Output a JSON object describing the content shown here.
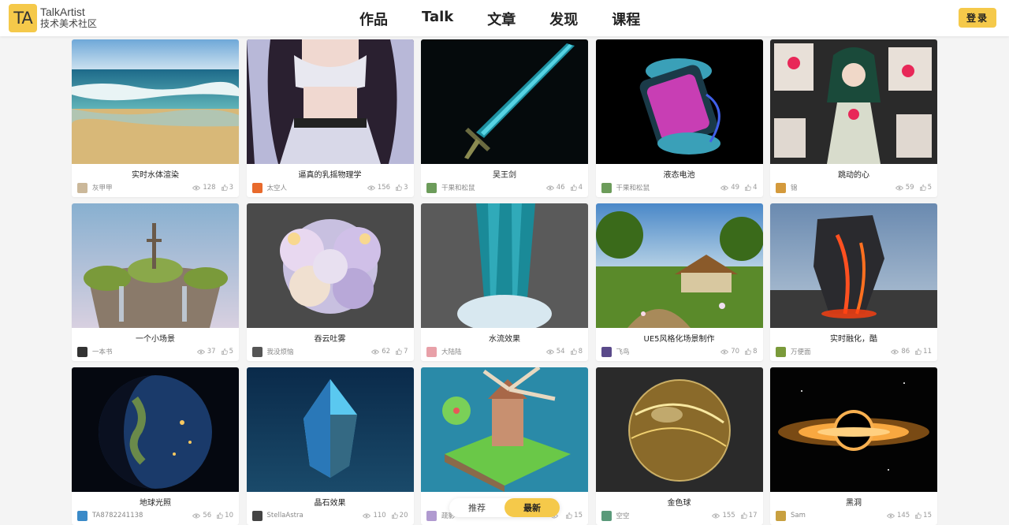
{
  "header": {
    "logo_mark": "TA",
    "logo_title": "TalkArtist",
    "logo_subtitle": "技术美术社区",
    "nav": [
      "作品",
      "Talk",
      "文章",
      "发现",
      "课程"
    ],
    "login_label": "登录"
  },
  "colors": {
    "accent": "#f5c94a",
    "background": "#f4f4f4"
  },
  "cards": [
    {
      "title": "实时水体渲染",
      "author": "灰甲甲",
      "views": "128",
      "likes": "3",
      "thumb": "ocean-beach",
      "avatar": "#cbb89a"
    },
    {
      "title": "逼真的乳摇物理学",
      "author": "太空人",
      "views": "156",
      "likes": "3",
      "thumb": "anime-girl-outfit",
      "avatar": "#e86a2c"
    },
    {
      "title": "吴王剑",
      "author": "干果和松鼠",
      "views": "46",
      "likes": "4",
      "thumb": "glowing-sword",
      "avatar": "#6c9c5a"
    },
    {
      "title": "液态电池",
      "author": "干果和松鼠",
      "views": "49",
      "likes": "4",
      "thumb": "liquid-battery",
      "avatar": "#6c9c5a"
    },
    {
      "title": "跳动的心",
      "author": "锦",
      "views": "59",
      "likes": "5",
      "thumb": "anime-heart-girl",
      "avatar": "#d49a3c"
    },
    {
      "title": "一个小场景",
      "author": "一本书",
      "views": "37",
      "likes": "5",
      "thumb": "floating-island-sword",
      "avatar": "#333333"
    },
    {
      "title": "吞云吐雾",
      "author": "我没烦恼",
      "views": "62",
      "likes": "7",
      "thumb": "cloud-smoke",
      "avatar": "#555555"
    },
    {
      "title": "水流效果",
      "author": "大陆陆",
      "views": "54",
      "likes": "8",
      "thumb": "waterfall",
      "avatar": "#e8a0a8"
    },
    {
      "title": "UE5风格化场景制作",
      "author": "飞鸟",
      "views": "70",
      "likes": "8",
      "thumb": "stylized-village",
      "avatar": "#5a4a8a"
    },
    {
      "title": "实时融化，酷",
      "author": "万便面",
      "views": "86",
      "likes": "11",
      "thumb": "melting-rock",
      "avatar": "#7a9a3a"
    },
    {
      "title": "地球光照",
      "author": "TA8782241138",
      "views": "56",
      "likes": "10",
      "thumb": "earth-lighting",
      "avatar": "#3a8ac8"
    },
    {
      "title": "晶石效果",
      "author": "StellaAstra",
      "views": "110",
      "likes": "20",
      "thumb": "crystal",
      "avatar": "#444444"
    },
    {
      "title": "",
      "author": "疏影",
      "views": "",
      "likes": "15",
      "thumb": "windmill-diorama",
      "avatar": "#b09ad0"
    },
    {
      "title": "金色球",
      "author": "空空",
      "views": "155",
      "likes": "17",
      "thumb": "golden-sphere",
      "avatar": "#5a9a7a"
    },
    {
      "title": "黑洞",
      "author": "Sam",
      "views": "145",
      "likes": "15",
      "thumb": "black-hole",
      "avatar": "#c8a040"
    }
  ],
  "feed_toggle": {
    "options": [
      "推荐",
      "最新"
    ],
    "active": "最新"
  }
}
